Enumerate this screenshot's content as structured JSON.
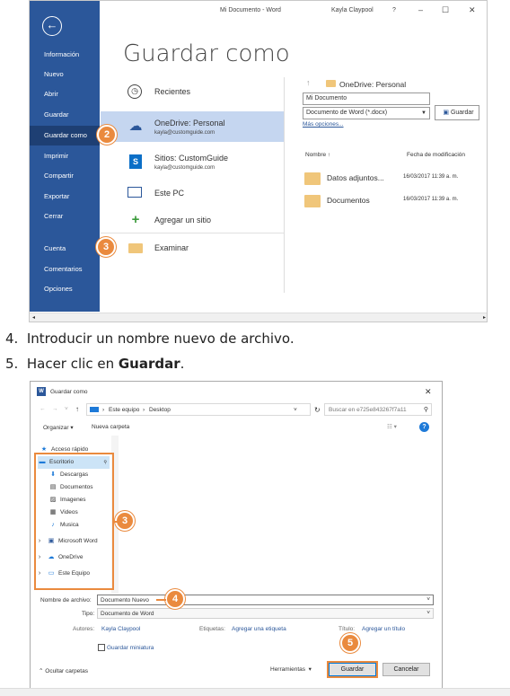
{
  "word": {
    "titlebar": {
      "doc": "Mi Documento  -  Word",
      "user": "Kayla Claypool",
      "help": "?",
      "minimize": "–",
      "maximize": "☐",
      "close": "✕"
    },
    "sidebar": {
      "back": "←",
      "items": [
        "Información",
        "Nuevo",
        "Abrir",
        "Guardar",
        "Guardar como",
        "Imprimir",
        "Compartir",
        "Exportar",
        "Cerrar",
        "Cuenta",
        "Comentarios",
        "Opciones"
      ]
    },
    "page_title": "Guardar como",
    "locations": [
      {
        "label": "Recientes",
        "sub": ""
      },
      {
        "label": "OneDrive: Personal",
        "sub": "kayla@customguide.com"
      },
      {
        "label": "Sitios: CustomGuide",
        "sub": "kayla@customguide.com"
      },
      {
        "label": "Este PC",
        "sub": ""
      },
      {
        "label": "Agregar un sitio",
        "sub": ""
      },
      {
        "label": "Examinar",
        "sub": ""
      }
    ],
    "right": {
      "path": "OneDrive: Personal",
      "filename": "Mi Documento",
      "filetype": "Documento de Word (*.docx)",
      "save_button": "Guardar",
      "more_options": "Más opciones...",
      "col_name": "Nombre ↑",
      "col_date": "Fecha de modificación",
      "files": [
        {
          "name": "Datos adjuntos...",
          "date": "16/03/2017 11:39 a. m."
        },
        {
          "name": "Documentos",
          "date": "16/03/2017 11:39 a. m."
        }
      ]
    },
    "callouts": [
      "2",
      "3"
    ]
  },
  "steps": [
    {
      "num": "4.",
      "text": "Introducir un nombre nuevo de archivo."
    },
    {
      "num": "5.",
      "text_before": "Hacer clic en ",
      "bold": "Guardar",
      "text_after": "."
    }
  ],
  "dialog": {
    "title": "Guardar como",
    "close": "✕",
    "breadcrumb": [
      "Este equipo",
      "Desktop"
    ],
    "search_placeholder": "Buscar en e725e843267f7a11",
    "organize": "Organizar ▾",
    "new_folder": "Nueva carpeta",
    "quick_access": "Acceso rápido",
    "tree": [
      "Escritorio",
      "Descargas",
      "Documentos",
      "Imagenes",
      "Videos",
      "Musica"
    ],
    "tree2": [
      "Microsoft Word",
      "OneDrive",
      "Este Equipo"
    ],
    "filename_label": "Nombre de archivo:",
    "filename_value": "Documento Nuevo",
    "type_label": "Tipo:",
    "type_value": "Documento de Word",
    "authors_label": "Autores:",
    "authors_value": "Kayla Claypool",
    "tags_label": "Etiquetas:",
    "tags_value": "Agregar una etiqueta",
    "titlef_label": "Título:",
    "titlef_value": "Agregar un título",
    "thumbnail": "Guardar miniatura",
    "hide_folders": "Ocultar carpetas",
    "tools": "Herramientas",
    "save": "Guardar",
    "cancel": "Cancelar",
    "callouts": [
      "3",
      "4",
      "5"
    ]
  }
}
